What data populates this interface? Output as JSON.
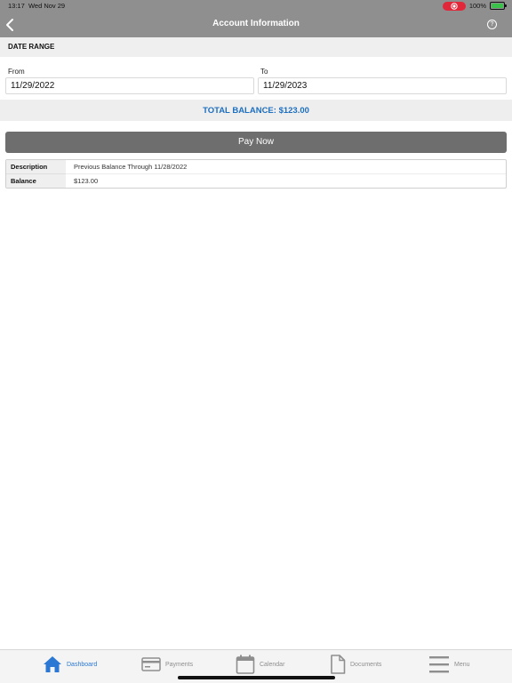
{
  "status_bar": {
    "time": "13:17",
    "date": "Wed Nov 29",
    "battery": "100%"
  },
  "header": {
    "title": "Account Information",
    "help_icon": "?"
  },
  "date_range": {
    "heading": "DATE RANGE",
    "from_label": "From",
    "from_value": "11/29/2022",
    "to_label": "To",
    "to_value": "11/29/2023"
  },
  "total_balance": "TOTAL BALANCE: $123.00",
  "pay_now_label": "Pay Now",
  "details": [
    {
      "key": "Description",
      "value": "Previous Balance Through 11/28/2022"
    },
    {
      "key": "Balance",
      "value": "$123.00"
    }
  ],
  "tabs": [
    {
      "label": "Dashboard",
      "icon": "home-icon",
      "active": true
    },
    {
      "label": "Payments",
      "icon": "credit-card-icon",
      "active": false
    },
    {
      "label": "Calendar",
      "icon": "calendar-icon",
      "active": false
    },
    {
      "label": "Documents",
      "icon": "document-icon",
      "active": false
    },
    {
      "label": "Menu",
      "icon": "menu-icon",
      "active": false
    }
  ],
  "colors": {
    "header_bg": "#8f8f8f",
    "accent": "#2a78d4",
    "total_text": "#1d6fc0",
    "pay_button": "#6e6e6e"
  }
}
